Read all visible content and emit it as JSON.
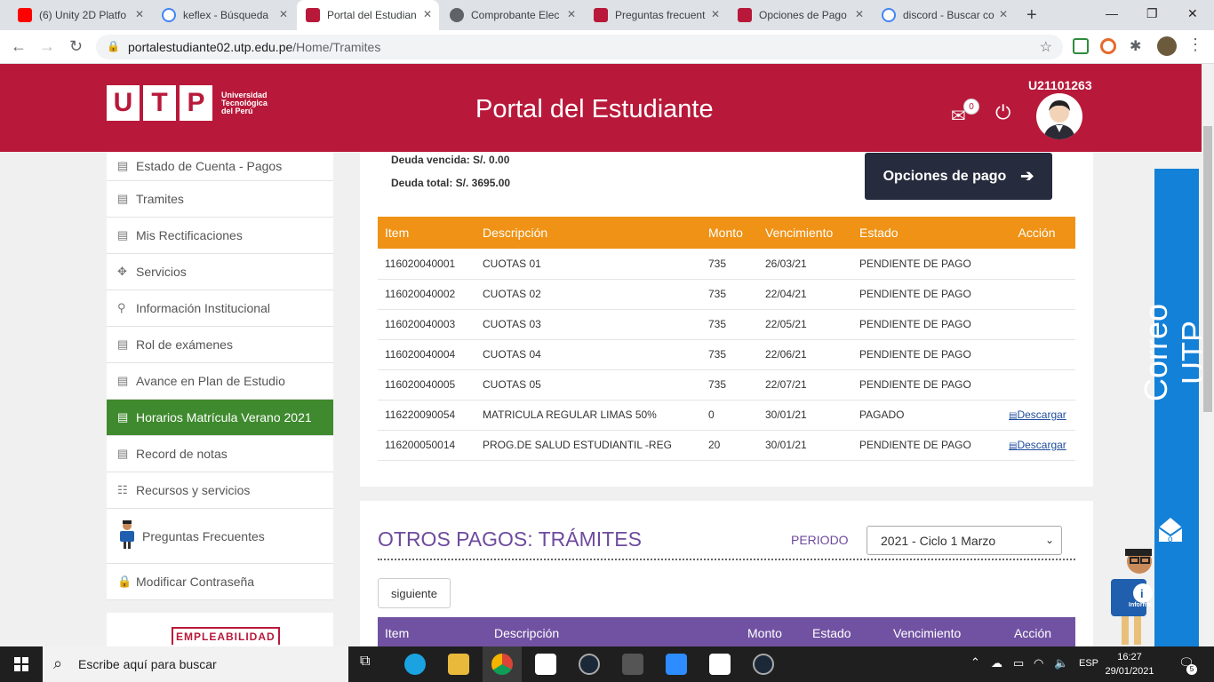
{
  "browser": {
    "tabs": [
      {
        "title": "(6) Unity 2D Platfo",
        "favicon": "youtube-icon"
      },
      {
        "title": "keflex - Búsqueda",
        "favicon": "google-icon"
      },
      {
        "title": "Portal del Estudian",
        "favicon": "utp-icon"
      },
      {
        "title": "Comprobante Elec",
        "favicon": "globe-icon"
      },
      {
        "title": "Preguntas frecuent",
        "favicon": "utp-icon"
      },
      {
        "title": "Opciones de Pago",
        "favicon": "utp-icon"
      },
      {
        "title": "discord - Buscar co",
        "favicon": "google-icon"
      }
    ],
    "url_host": "portalestudiante02.utp.edu.pe",
    "url_path": "/Home/Tramites"
  },
  "header": {
    "logo_letters": [
      "U",
      "T",
      "P"
    ],
    "logo_text": "Universidad Tecnológica del Perú",
    "title": "Portal del Estudiante",
    "user_code": "U21101263",
    "mail_count": "0"
  },
  "sidebar": {
    "items": [
      {
        "label": "Estado de Cuenta - Pagos",
        "icon": "list-icon"
      },
      {
        "label": "Tramites",
        "icon": "list-icon"
      },
      {
        "label": "Mis Rectificaciones",
        "icon": "list-icon"
      },
      {
        "label": "Servicios",
        "icon": "move-icon"
      },
      {
        "label": "Información Institucional",
        "icon": "map-pin-icon"
      },
      {
        "label": "Rol de exámenes",
        "icon": "list-icon"
      },
      {
        "label": "Avance en Plan de Estudio",
        "icon": "list-icon"
      },
      {
        "label": "Horarios Matrícula Verano 2021",
        "icon": "list-icon"
      },
      {
        "label": "Record de notas",
        "icon": "list-icon"
      },
      {
        "label": "Recursos y servicios",
        "icon": "grid-list-icon"
      },
      {
        "label": "Preguntas Frecuentes",
        "icon": "mascot-icon"
      },
      {
        "label": "Modificar Contraseña",
        "icon": "lock-icon"
      }
    ],
    "empleabilidad": "EMPLEABILIDAD"
  },
  "payments": {
    "deuda_vencida": "Deuda vencida: S/. 0.00",
    "deuda_total": "Deuda total: S/. 3695.00",
    "pay_button": "Opciones de pago",
    "columns": [
      "Item",
      "Descripción",
      "Monto",
      "Vencimiento",
      "Estado",
      "Acción"
    ],
    "rows": [
      {
        "item": "116020040001",
        "desc": "CUOTAS 01",
        "monto": "735",
        "venc": "26/03/21",
        "estado": "PENDIENTE DE PAGO",
        "accion": ""
      },
      {
        "item": "116020040002",
        "desc": "CUOTAS 02",
        "monto": "735",
        "venc": "22/04/21",
        "estado": "PENDIENTE DE PAGO",
        "accion": ""
      },
      {
        "item": "116020040003",
        "desc": "CUOTAS 03",
        "monto": "735",
        "venc": "22/05/21",
        "estado": "PENDIENTE DE PAGO",
        "accion": ""
      },
      {
        "item": "116020040004",
        "desc": "CUOTAS 04",
        "monto": "735",
        "venc": "22/06/21",
        "estado": "PENDIENTE DE PAGO",
        "accion": ""
      },
      {
        "item": "116020040005",
        "desc": "CUOTAS 05",
        "monto": "735",
        "venc": "22/07/21",
        "estado": "PENDIENTE DE PAGO",
        "accion": ""
      },
      {
        "item": "116220090054",
        "desc": "MATRICULA REGULAR LIMAS 50%",
        "monto": "0",
        "venc": "30/01/21",
        "estado": "PAGADO",
        "accion": "Descargar"
      },
      {
        "item": "116200050014",
        "desc": "PROG.DE SALUD ESTUDIANTIL -REG",
        "monto": "20",
        "venc": "30/01/21",
        "estado": "PENDIENTE DE PAGO",
        "accion": "Descargar"
      }
    ]
  },
  "tramites": {
    "title": "OTROS PAGOS: TRÁMITES",
    "periodo_label": "PERIODO",
    "periodo_value": "2021 - Ciclo 1 Marzo",
    "next_button": "siguiente",
    "columns": [
      "Item",
      "Descripción",
      "Monto",
      "Estado",
      "Vencimiento",
      "Acción"
    ]
  },
  "correo": "Correo UTP",
  "mascot_text": "Informa",
  "taskbar": {
    "search_placeholder": "Escribe aquí para buscar",
    "lang": "ESP",
    "time": "16:27",
    "date": "29/01/2021",
    "notif": "5"
  },
  "colors": {
    "brand": "#b8193a",
    "orange": "#ef9215",
    "purple": "#7152a2",
    "green": "#3f8a2e",
    "blue": "#1481d8",
    "navy": "#262b3d"
  }
}
